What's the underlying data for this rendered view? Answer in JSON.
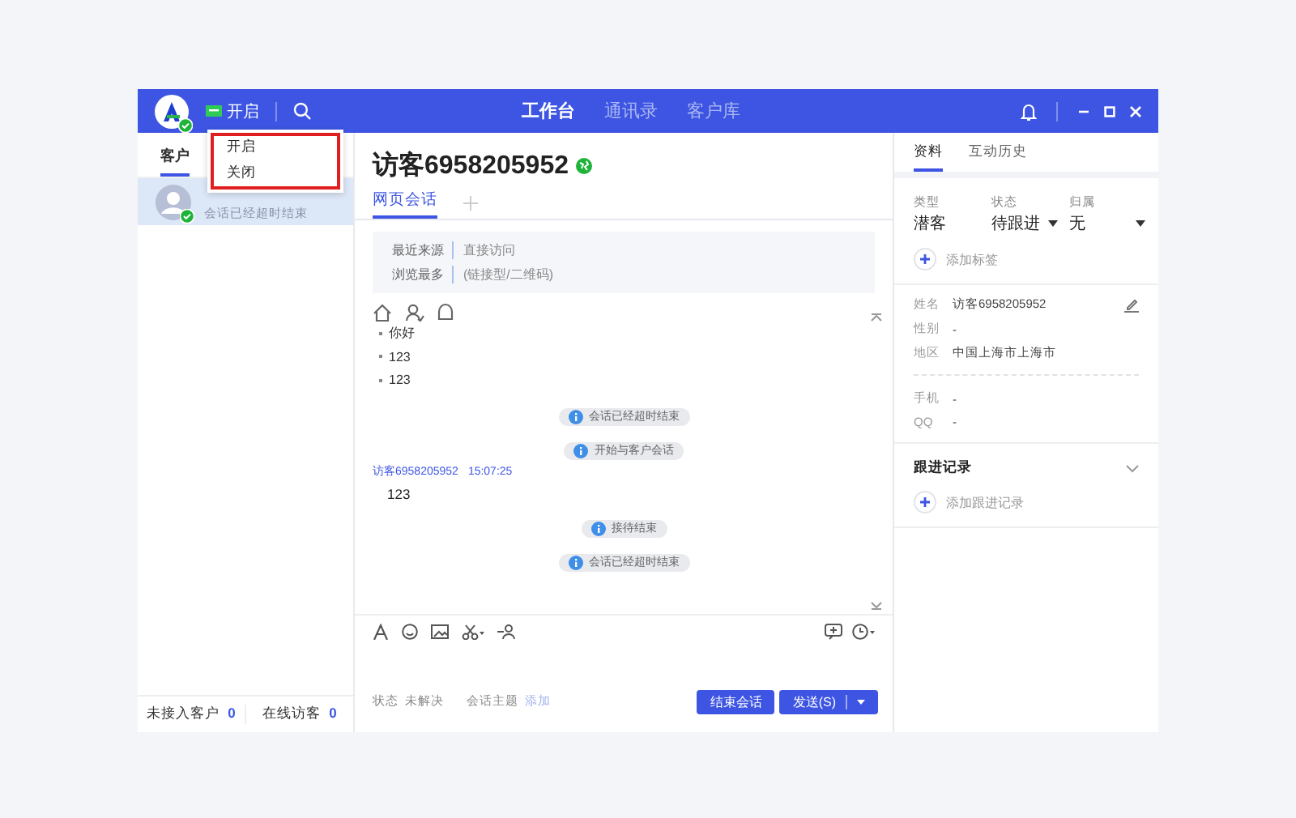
{
  "app_bar": {
    "status_label": "开启",
    "online": true,
    "nav": [
      {
        "label": "工作台",
        "selected": true
      },
      {
        "label": "通讯录",
        "selected": false
      },
      {
        "label": "客户库",
        "selected": false
      }
    ]
  },
  "status_menu": {
    "items": [
      "开启",
      "关闭"
    ]
  },
  "left_panel": {
    "tabs": [
      {
        "label": "客户",
        "selected": true
      }
    ],
    "sessions": [
      {
        "preview": "会话已经超时结束",
        "selected": true,
        "online": true
      }
    ],
    "footer": [
      {
        "label": "未接入客户",
        "count": "0"
      },
      {
        "label": "在线访客",
        "count": "0"
      }
    ]
  },
  "chat": {
    "title": "访客6958205952",
    "online": true,
    "tabs": [
      {
        "label": "网页会话",
        "selected": true
      }
    ],
    "info": [
      {
        "label": "最近来源",
        "value": "直接访问"
      },
      {
        "label": "浏览最多",
        "value": "(链接型/二维码)"
      }
    ],
    "quick_replies": [
      "你好",
      "123",
      "123"
    ],
    "messages": [
      {
        "kind": "system",
        "text": "会话已经超时结束"
      },
      {
        "kind": "system",
        "text": "开始与客户会话"
      },
      {
        "kind": "visitor",
        "sender": "访客6958205952",
        "time": "15:07:25",
        "text": "123"
      },
      {
        "kind": "system",
        "text": "接待结束"
      },
      {
        "kind": "system",
        "text": "会话已经超时结束"
      }
    ],
    "footer": {
      "status_label": "状态",
      "status": "未解决",
      "topic_label": "会话主题",
      "topic_action": "添加"
    },
    "end_button": "结束会话",
    "send_button": "发送(S)"
  },
  "profile": {
    "tabs": [
      {
        "label": "资料",
        "selected": true
      },
      {
        "label": "互动历史",
        "selected": false
      }
    ],
    "attributes": [
      {
        "label": "类型",
        "value": "潜客",
        "dropdown": false
      },
      {
        "label": "状态",
        "value": "待跟进",
        "dropdown": true
      },
      {
        "label": "归属",
        "value": "无",
        "dropdown": true
      }
    ],
    "add_tag": "添加标签",
    "field_groups": [
      {
        "fields": [
          {
            "label": "姓名",
            "value": "访客6958205952",
            "editable": true
          },
          {
            "label": "性别",
            "value": "-",
            "editable": false
          },
          {
            "label": "地区",
            "value": "中国上海市上海市",
            "editable": false
          }
        ]
      },
      {
        "fields": [
          {
            "label": "手机",
            "value": "-",
            "editable": false
          },
          {
            "label": "QQ",
            "value": "-",
            "editable": false
          }
        ]
      }
    ],
    "follow_up": {
      "title": "跟进记录",
      "add": "添加跟进记录"
    }
  }
}
